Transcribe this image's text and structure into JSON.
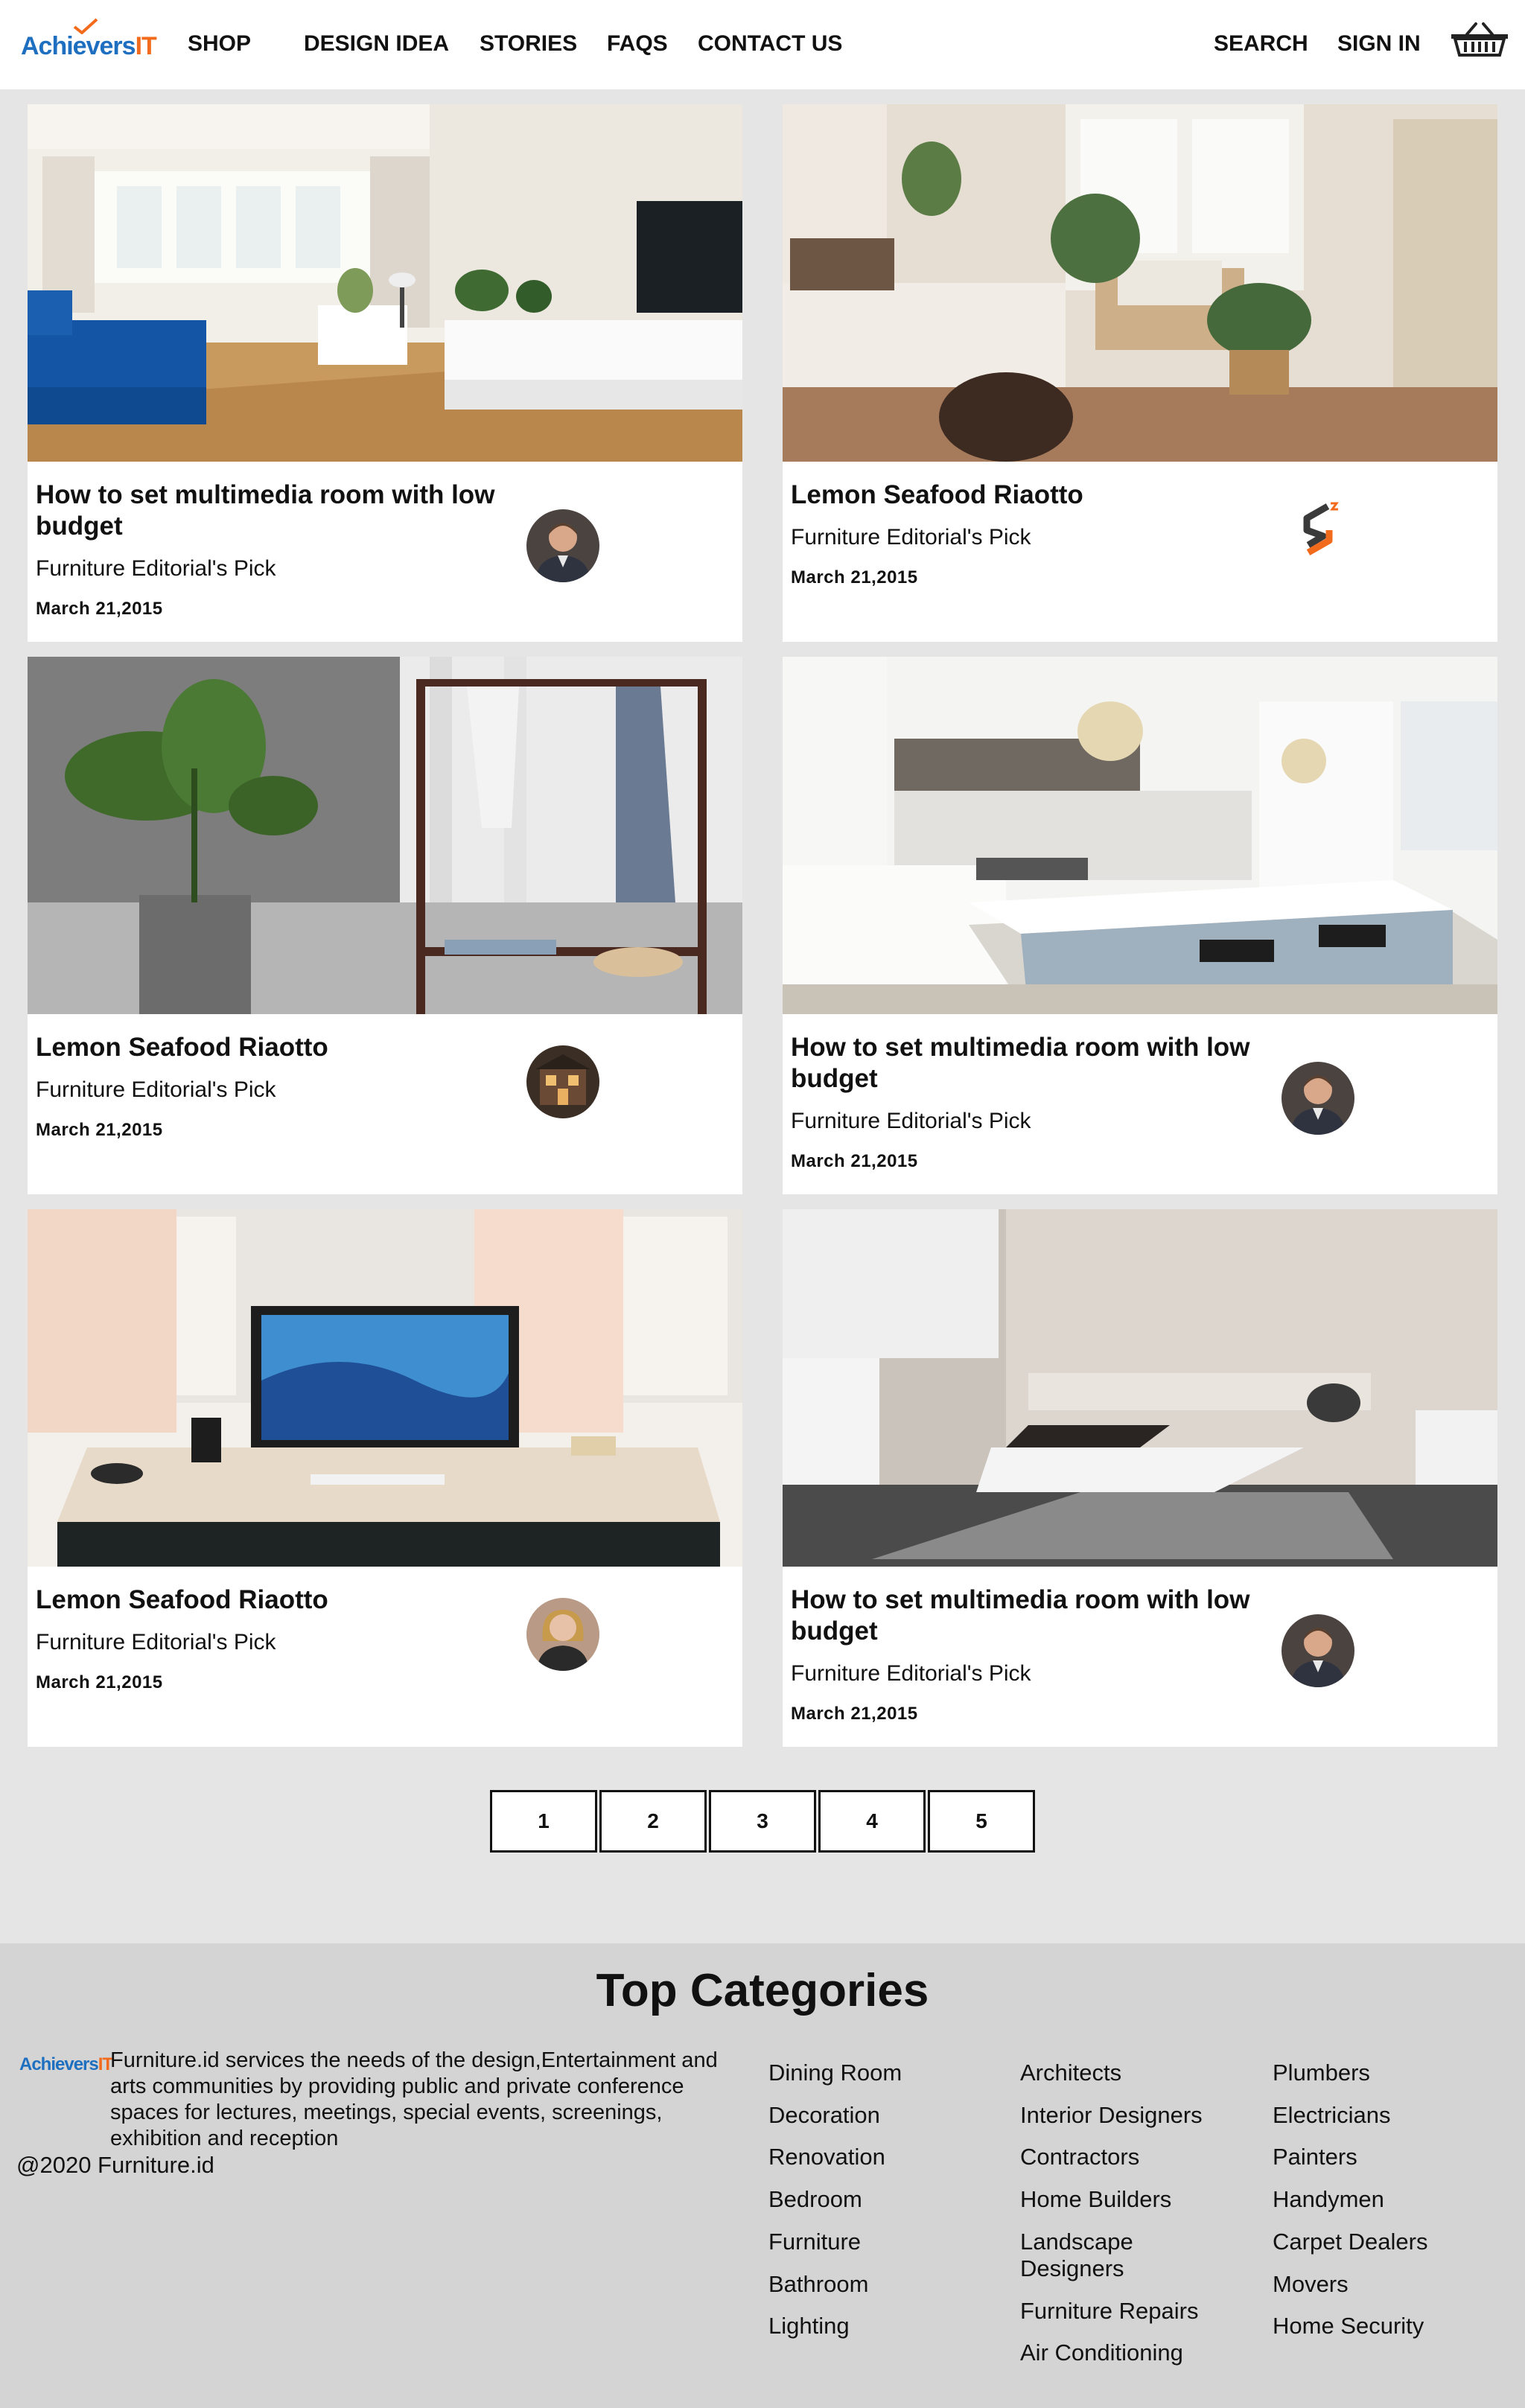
{
  "header": {
    "logo": {
      "part1": "Achie",
      "part2": "vers",
      "part3": "IT"
    },
    "nav": {
      "shop": "SHOP",
      "design_idea": "DESIGN IDEA",
      "stories": "STORIES",
      "faqs": "FAQS",
      "contact_us": "CONTACT US",
      "search": "SEARCH",
      "sign_in": "SIGN IN"
    },
    "cart_icon": "basket-icon"
  },
  "cards": [
    {
      "title": "How to set multimedia room with low budget",
      "subtitle": "Furniture Editorial's Pick",
      "date": "March 21,2015",
      "image": "living-room-photo",
      "avatar": "man-avatar"
    },
    {
      "title": "Lemon Seafood Riaotto",
      "subtitle": "Furniture Editorial's Pick",
      "date": "March 21,2015",
      "image": "bedroom-plants-photo",
      "avatar": "s-logo-avatar"
    },
    {
      "title": "Lemon Seafood Riaotto",
      "subtitle": "Furniture Editorial's Pick",
      "date": "March 21,2015",
      "image": "plant-clothes-rack-photo",
      "avatar": "house-avatar"
    },
    {
      "title": "How to set multimedia room with low budget",
      "subtitle": "Furniture Editorial's Pick",
      "date": "March 21,2015",
      "image": "white-kitchen-photo",
      "avatar": "man-avatar"
    },
    {
      "title": "Lemon Seafood Riaotto",
      "subtitle": "Furniture Editorial's Pick",
      "date": "March 21,2015",
      "image": "desk-computer-photo",
      "avatar": "woman-avatar"
    },
    {
      "title": "How to set multimedia room with low budget",
      "subtitle": "Furniture Editorial's Pick",
      "date": "March 21,2015",
      "image": "sofa-living-room-photo",
      "avatar": "man-avatar"
    }
  ],
  "pagination": {
    "pages": [
      "1",
      "2",
      "3",
      "4",
      "5"
    ]
  },
  "footer": {
    "heading": "Top Categories",
    "description": "Furniture.id services the needs of the design,Entertainment and arts communities by providing public and private conference spaces for lectures, meetings, special events, screenings, exhibition and reception",
    "copyright": "@2020 Furniture.id",
    "columns": [
      [
        "Dining Room",
        "Decoration",
        "Renovation",
        "Bedroom",
        "Furniture",
        "Bathroom",
        "Lighting"
      ],
      [
        "Architects",
        "Interior Designers",
        "Contractors",
        "Home Builders",
        "Landscape Designers",
        "Furniture Repairs",
        "Air Conditioning"
      ],
      [
        "Plumbers",
        "Electricians",
        "Painters",
        "Handymen",
        "Carpet Dealers",
        "Movers",
        "Home Security"
      ]
    ]
  },
  "colors": {
    "logo_blue": "#1f6fc0",
    "logo_orange": "#f26b1d",
    "page_bg": "#e5e5e5",
    "footer_bg": "#d4d4d4"
  }
}
